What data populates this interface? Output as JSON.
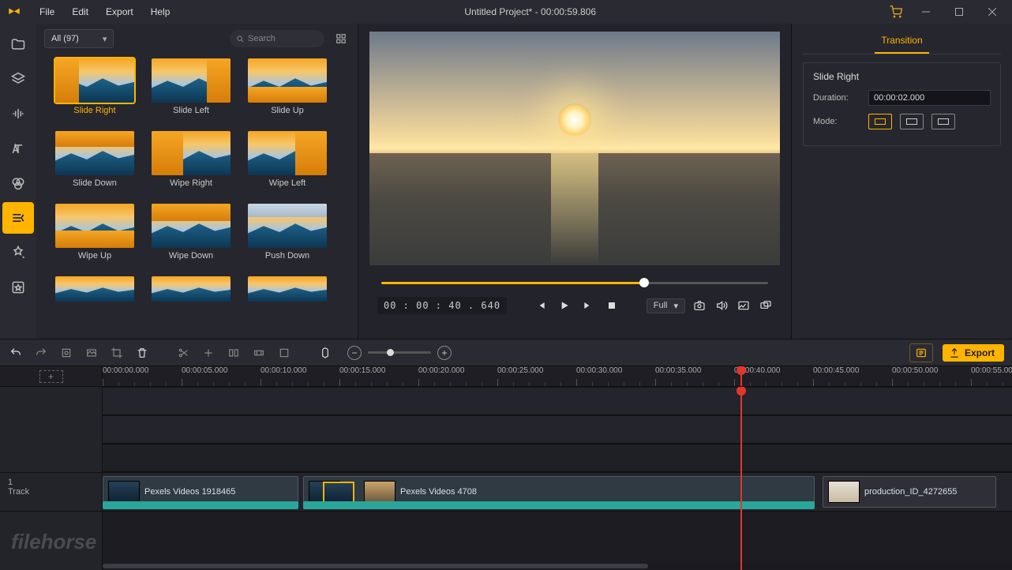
{
  "app": {
    "title": "Untitled Project* - 00:00:59.806"
  },
  "menu": {
    "file": "File",
    "edit": "Edit",
    "export": "Export",
    "help": "Help"
  },
  "library": {
    "filter": "All (97)",
    "search_placeholder": "Search",
    "items": [
      {
        "label": "Slide Right"
      },
      {
        "label": "Slide Left"
      },
      {
        "label": "Slide Up"
      },
      {
        "label": "Slide Down"
      },
      {
        "label": "Wipe Right"
      },
      {
        "label": "Wipe Left"
      },
      {
        "label": "Wipe Up"
      },
      {
        "label": "Wipe Down"
      },
      {
        "label": "Push Down"
      },
      {
        "label": ""
      },
      {
        "label": ""
      },
      {
        "label": ""
      }
    ]
  },
  "preview": {
    "timecode": "00 : 00 : 40 . 640",
    "ratio": "Full"
  },
  "inspector": {
    "tab": "Transition",
    "name": "Slide Right",
    "duration_label": "Duration:",
    "duration": "00:00:02.000",
    "mode_label": "Mode:"
  },
  "toolbar": {
    "export": "Export"
  },
  "timeline": {
    "ticks": [
      "00:00:00.000",
      "00:00:05.000",
      "00:00:10.000",
      "00:00:15.000",
      "00:00:20.000",
      "00:00:25.000",
      "00:00:30.000",
      "00:00:35.000",
      "00:00:40.000",
      "00:00:45.000",
      "00:00:50.000",
      "00:00:55.000"
    ],
    "gutter": {
      "index": "1",
      "label": "Track"
    },
    "clips": {
      "clip1": "Pexels Videos 1918465",
      "clip2": "Pexels Videos 4708",
      "clip3": "production_ID_4272655"
    }
  },
  "watermark": "filehorse"
}
